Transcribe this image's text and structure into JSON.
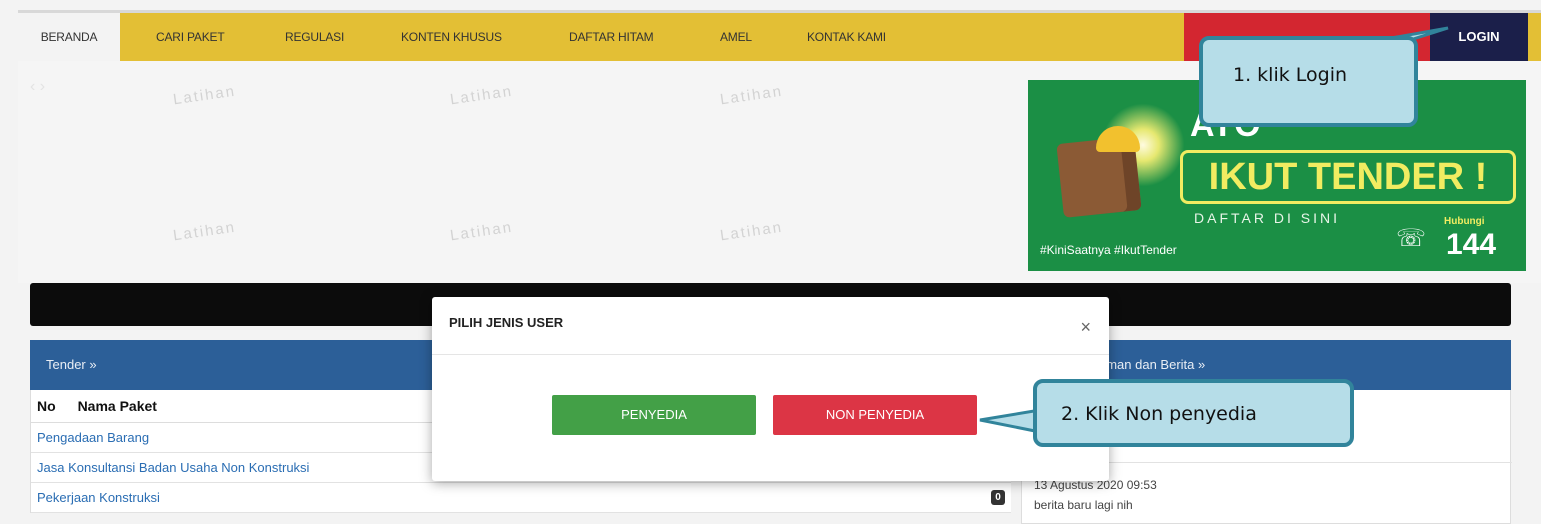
{
  "nav": {
    "items": [
      {
        "label": "BERANDA"
      },
      {
        "label": "CARI PAKET"
      },
      {
        "label": "REGULASI"
      },
      {
        "label": "KONTEN KHUSUS"
      },
      {
        "label": "DAFTAR HITAM"
      },
      {
        "label": "AMEL"
      },
      {
        "label": "KONTAK KAMI"
      }
    ],
    "login_label": "LOGIN"
  },
  "slider": {
    "watermark": "Latihan",
    "arrows": "‹ ›"
  },
  "banner": {
    "ayo": "AYO",
    "ikut_tender": "IKUT TENDER !",
    "daftar": "DAFTAR DI SINI",
    "hashtag": "#KiniSaatnya #IkutTender",
    "hubungi": "Hubungi",
    "number": "144"
  },
  "tender_panel": {
    "title": "Tender »",
    "headers": [
      "No",
      "Nama Paket"
    ],
    "rows": [
      {
        "label": "Pengadaan Barang",
        "count": ""
      },
      {
        "label": "Jasa Konsultansi Badan Usaha Non Konstruksi",
        "count": ""
      },
      {
        "label": "Pekerjaan Konstruksi",
        "count": "0"
      }
    ]
  },
  "news_panel": {
    "title": "uman dan Berita »",
    "date": "13 Agustus 2020 09:53",
    "headline": "berita baru lagi nih"
  },
  "modal": {
    "title": "PILIH JENIS USER",
    "close": "×",
    "penyedia_label": "PENYEDIA",
    "non_penyedia_label": "NON PENYEDIA"
  },
  "callouts": {
    "step1": "1. klik Login",
    "step2": "2. Klik Non penyedia"
  },
  "colors": {
    "nav_bg": "#e3bf35",
    "login_bg": "#1b1f4a",
    "panel_head": "#2c5f98",
    "green_button": "#43a047",
    "red_button": "#dc3545",
    "callout_fill": "#b6dde8",
    "callout_border": "#31849b"
  }
}
